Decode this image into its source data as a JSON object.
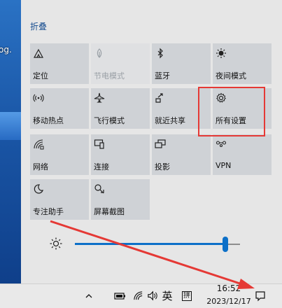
{
  "desktop": {
    "label": "og."
  },
  "action_center": {
    "collapse_label": "折叠",
    "tiles": [
      {
        "label": "定位",
        "icon": "location-icon"
      },
      {
        "label": "节电模式",
        "icon": "battery-saver-icon"
      },
      {
        "label": "蓝牙",
        "icon": "bluetooth-icon"
      },
      {
        "label": "夜间模式",
        "icon": "night-light-icon"
      },
      {
        "label": "移动热点",
        "icon": "mobile-hotspot-icon"
      },
      {
        "label": "飞行模式",
        "icon": "airplane-icon"
      },
      {
        "label": "就近共享",
        "icon": "nearby-share-icon"
      },
      {
        "label": "所有设置",
        "icon": "settings-gear-icon"
      },
      {
        "label": "网络",
        "icon": "network-icon"
      },
      {
        "label": "连接",
        "icon": "connect-icon"
      },
      {
        "label": "投影",
        "icon": "project-icon"
      },
      {
        "label": "VPN",
        "icon": "vpn-icon"
      },
      {
        "label": "专注助手",
        "icon": "focus-assist-icon"
      },
      {
        "label": "屏幕截图",
        "icon": "screenshot-icon"
      }
    ],
    "brightness": {
      "icon": "brightness-icon",
      "value_fraction": 0.91
    }
  },
  "taskbar": {
    "ime_language": "英",
    "ime_mode": "拼",
    "time": "16:52",
    "date": "2023/12/17",
    "colors": {
      "accent": "#0d70c8",
      "highlight": "#e53935"
    }
  }
}
